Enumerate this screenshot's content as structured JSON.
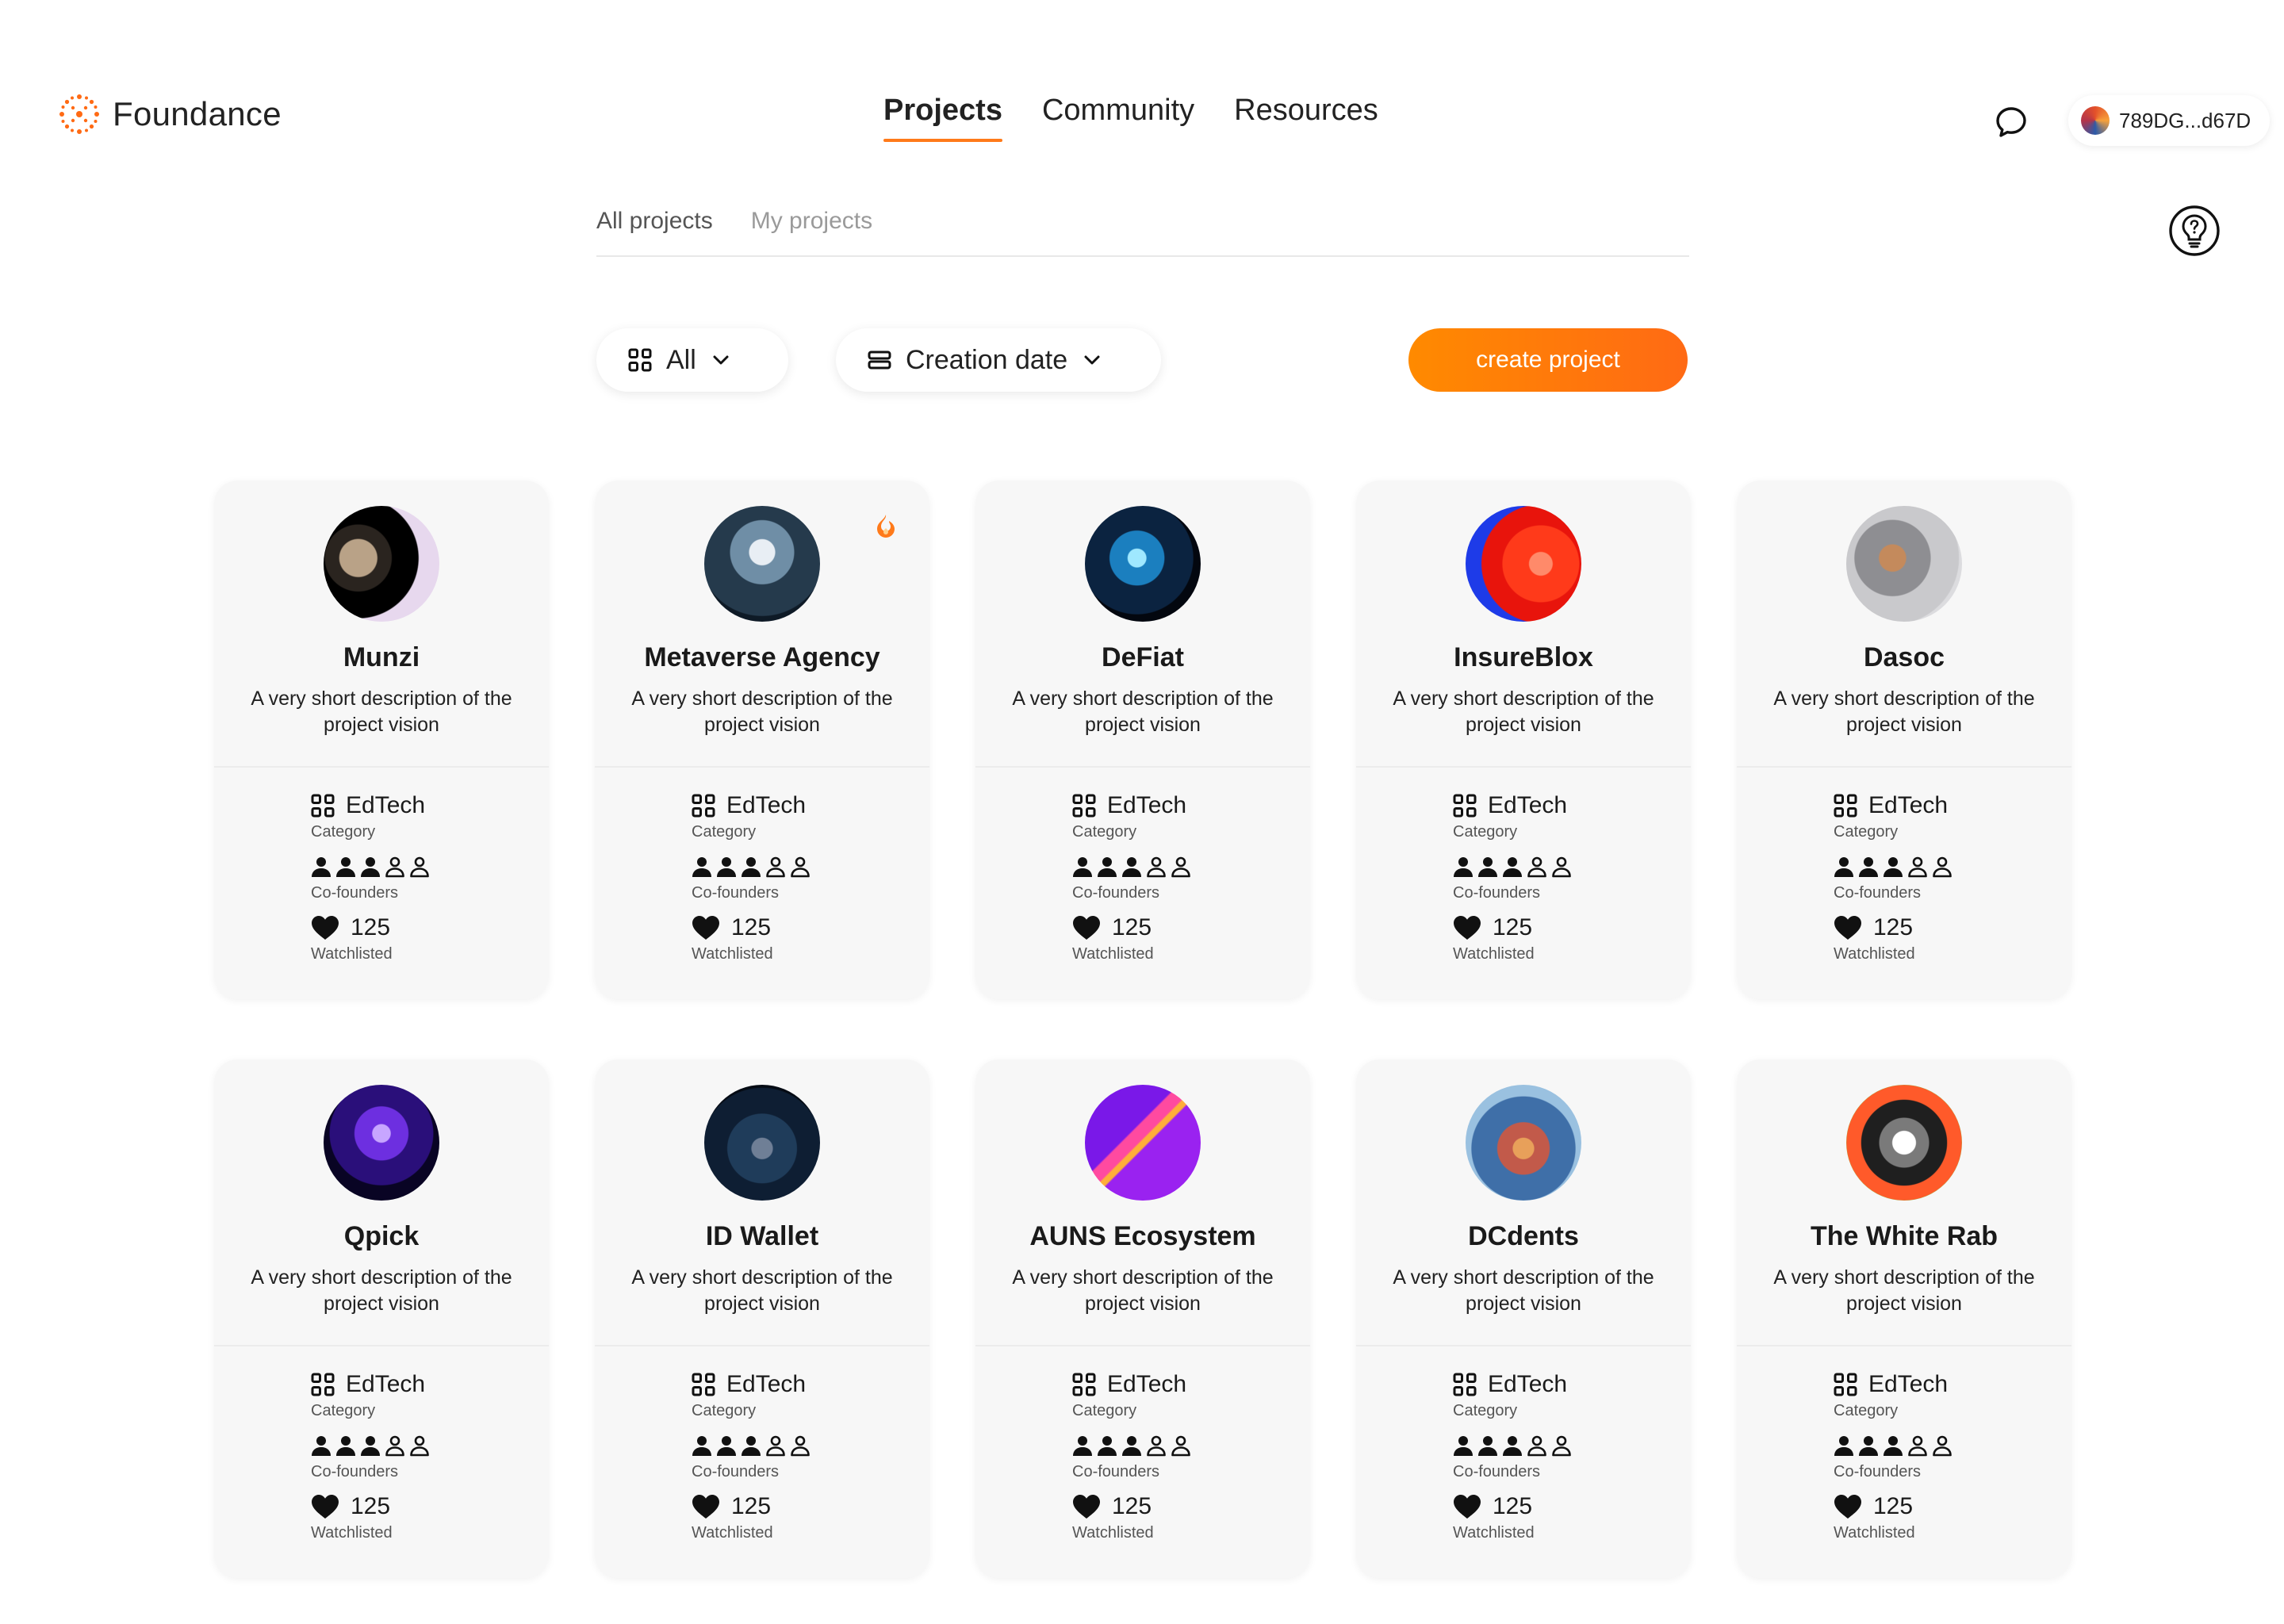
{
  "brand": {
    "name": "Foundance",
    "logo_icon": "sun-dots-logo",
    "accent": "#ff7a1a"
  },
  "nav": {
    "items": [
      {
        "label": "Projects",
        "active": true
      },
      {
        "label": "Community",
        "active": false
      },
      {
        "label": "Resources",
        "active": false
      }
    ],
    "chat_icon": "chat-bubble-icon",
    "wallet": {
      "address": "789DG...d67D"
    },
    "help_icon": "lightbulb-question-icon"
  },
  "subtabs": [
    {
      "label": "All projects",
      "active": true
    },
    {
      "label": "My projects",
      "active": false
    }
  ],
  "filters": {
    "category": {
      "icon": "grid-icon",
      "label": "All"
    },
    "sort": {
      "icon": "sort-list-icon",
      "label": "Creation date"
    },
    "create_label": "create project"
  },
  "stat_labels": {
    "category": "Category",
    "cofounders": "Co-founders",
    "watchlisted": "Watchlisted"
  },
  "projects": [
    {
      "title": "Munzi",
      "desc": "A very short description of the project vision",
      "category": "EdTech",
      "cofounders_filled": 3,
      "cofounders_total": 5,
      "watchlisted": "125",
      "hot": false
    },
    {
      "title": "Metaverse Agency",
      "desc": "A very short description of the project vision",
      "category": "EdTech",
      "cofounders_filled": 3,
      "cofounders_total": 5,
      "watchlisted": "125",
      "hot": true
    },
    {
      "title": "DeFiat",
      "desc": "A very short description of the project vision",
      "category": "EdTech",
      "cofounders_filled": 3,
      "cofounders_total": 5,
      "watchlisted": "125",
      "hot": false
    },
    {
      "title": "InsureBlox",
      "desc": "A very short description of the project vision",
      "category": "EdTech",
      "cofounders_filled": 3,
      "cofounders_total": 5,
      "watchlisted": "125",
      "hot": false
    },
    {
      "title": "Dasoc",
      "desc": "A very short description of the project vision",
      "category": "EdTech",
      "cofounders_filled": 3,
      "cofounders_total": 5,
      "watchlisted": "125",
      "hot": false
    },
    {
      "title": "Qpick",
      "desc": "A very short description of the project vision",
      "category": "EdTech",
      "cofounders_filled": 3,
      "cofounders_total": 5,
      "watchlisted": "125",
      "hot": false
    },
    {
      "title": "ID Wallet",
      "desc": "A very short description of the project vision",
      "category": "EdTech",
      "cofounders_filled": 3,
      "cofounders_total": 5,
      "watchlisted": "125",
      "hot": false
    },
    {
      "title": "AUNS Ecosystem",
      "desc": "A very short description of the project vision",
      "category": "EdTech",
      "cofounders_filled": 3,
      "cofounders_total": 5,
      "watchlisted": "125",
      "hot": false
    },
    {
      "title": "DCdents",
      "desc": "A very short description of the project vision",
      "category": "EdTech",
      "cofounders_filled": 3,
      "cofounders_total": 5,
      "watchlisted": "125",
      "hot": false
    },
    {
      "title": "The White Rab",
      "desc": "A very short description of the project vision",
      "category": "EdTech",
      "cofounders_filled": 3,
      "cofounders_total": 5,
      "watchlisted": "125",
      "hot": false
    }
  ]
}
